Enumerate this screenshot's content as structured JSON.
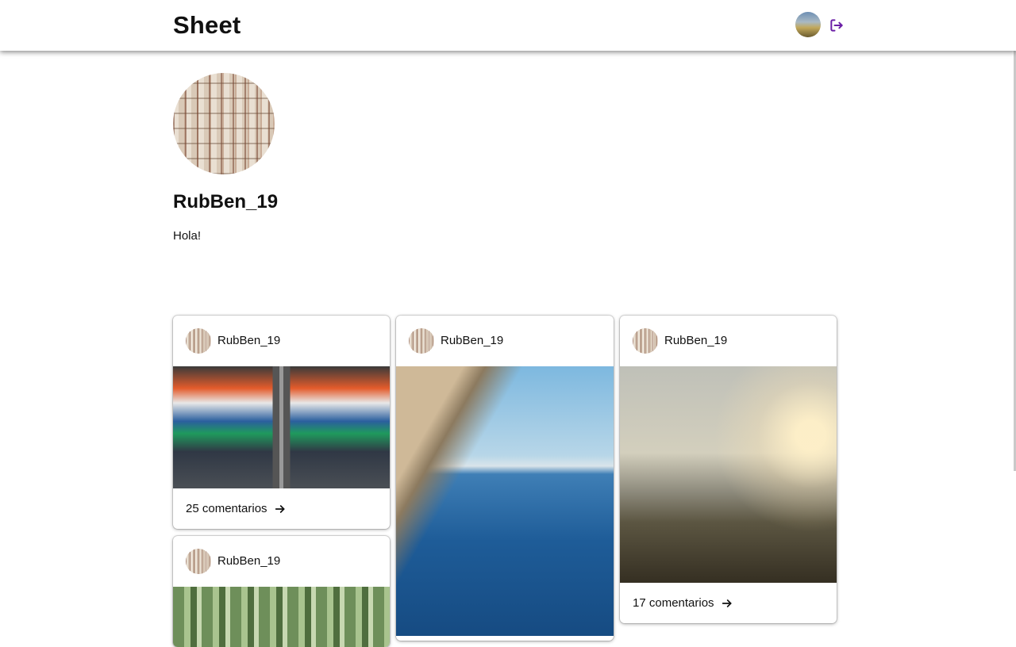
{
  "app": {
    "title": "Sheet"
  },
  "header": {
    "avatar_icon": "user-avatar-icon",
    "logout_icon": "logout-icon",
    "accent_color": "#6b1fa6"
  },
  "profile": {
    "username": "RubBen_19",
    "bio": "Hola!"
  },
  "posts": [
    {
      "author": "RubBen_19",
      "image": "clothes-rack-photo",
      "comments_label": "25 comentarios"
    },
    {
      "author": "RubBen_19",
      "image": "sea-cliff-photo",
      "comments_label": ""
    },
    {
      "author": "RubBen_19",
      "image": "valley-sunset-photo",
      "comments_label": "17 comentarios"
    },
    {
      "author": "RubBen_19",
      "image": "bamboo-photo",
      "comments_label": ""
    }
  ]
}
